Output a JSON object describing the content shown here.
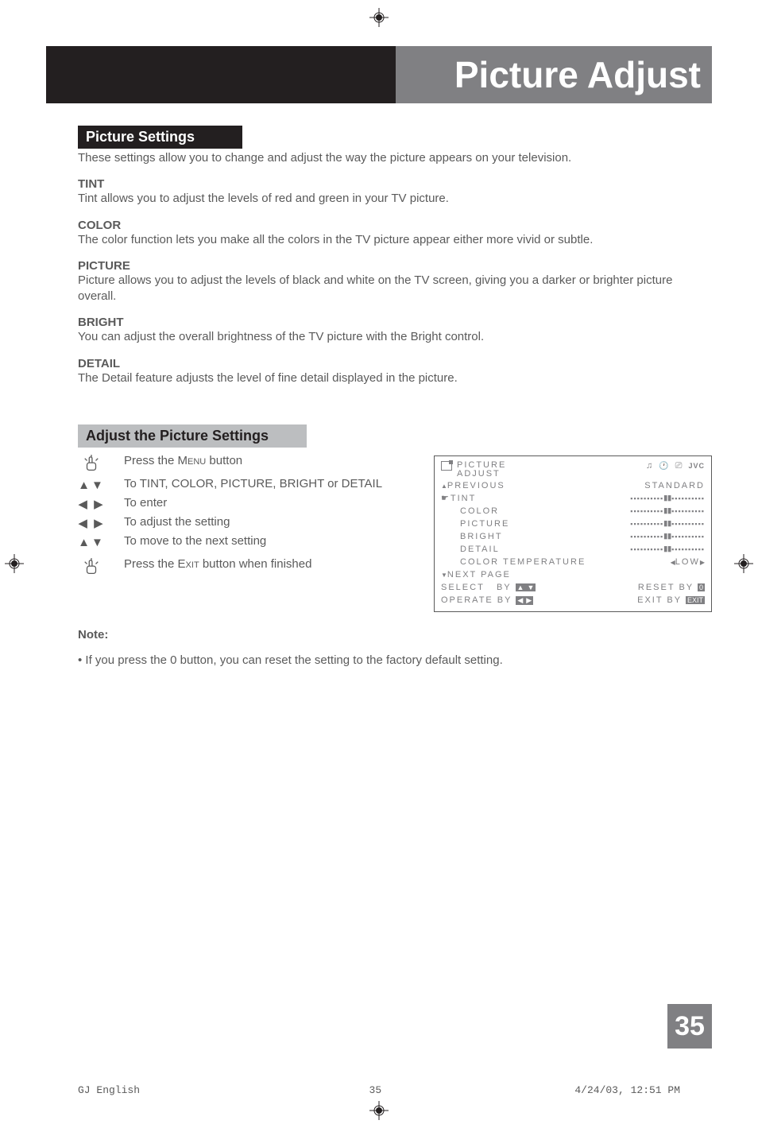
{
  "header": {
    "title": "Picture Adjust"
  },
  "sections": {
    "pictureSettings": {
      "heading": "Picture Settings",
      "intro": "These settings allow you to change and adjust the way the picture appears on your television.",
      "items": [
        {
          "label": "TINT",
          "desc": "Tint allows you to adjust the levels of red and green in your TV picture."
        },
        {
          "label": "COLOR",
          "desc": "The color function lets you make all the colors in the TV picture appear either more vivid or subtle."
        },
        {
          "label": "PICTURE",
          "desc": "Picture allows you to adjust the levels of black and white on the TV screen, giving you a darker or brighter picture overall."
        },
        {
          "label": "BRIGHT",
          "desc": "You can adjust the overall brightness of the TV picture with the Bright control."
        },
        {
          "label": "DETAIL",
          "desc": "The Detail feature adjusts the level of fine detail displayed in the picture."
        }
      ]
    },
    "adjust": {
      "heading": "Adjust the Picture Settings",
      "steps": [
        {
          "icon": "hand",
          "text_pre": "Press the M",
          "text_sc": "enu",
          "text_post": " button"
        },
        {
          "icon": "updown",
          "text": "To TINT, COLOR, PICTURE, BRIGHT or DETAIL"
        },
        {
          "icon": "leftright",
          "text": "To enter"
        },
        {
          "icon": "leftright",
          "text": "To adjust the setting"
        },
        {
          "icon": "updown",
          "text": "To move to the next setting"
        },
        {
          "icon": "hand",
          "text_pre": "Press the E",
          "text_sc": "xit",
          "text_post": " button when finished"
        }
      ]
    }
  },
  "osd": {
    "title1": "PICTURE",
    "title2": "ADJUST",
    "jvc": "JVC",
    "previous": "PREVIOUS",
    "standard": "STANDARD",
    "rows": [
      "TINT",
      "COLOR",
      "PICTURE",
      "BRIGHT",
      "DETAIL"
    ],
    "colortemp": "COLOR TEMPERATURE",
    "low": "LOW",
    "nextpage": "NEXT PAGE",
    "select": "SELECT",
    "by": "BY",
    "reset": "RESET BY",
    "zero": "0",
    "operate": "OPERATE BY",
    "exit": "EXIT BY",
    "exitbtn": "EXIT"
  },
  "note": {
    "label": "Note:",
    "bullet": "•  If you press the 0 button, you can reset the setting to the factory default setting."
  },
  "pageNumber": "35",
  "footer": {
    "left": "GJ English",
    "center": "35",
    "right": "4/24/03, 12:51 PM"
  }
}
